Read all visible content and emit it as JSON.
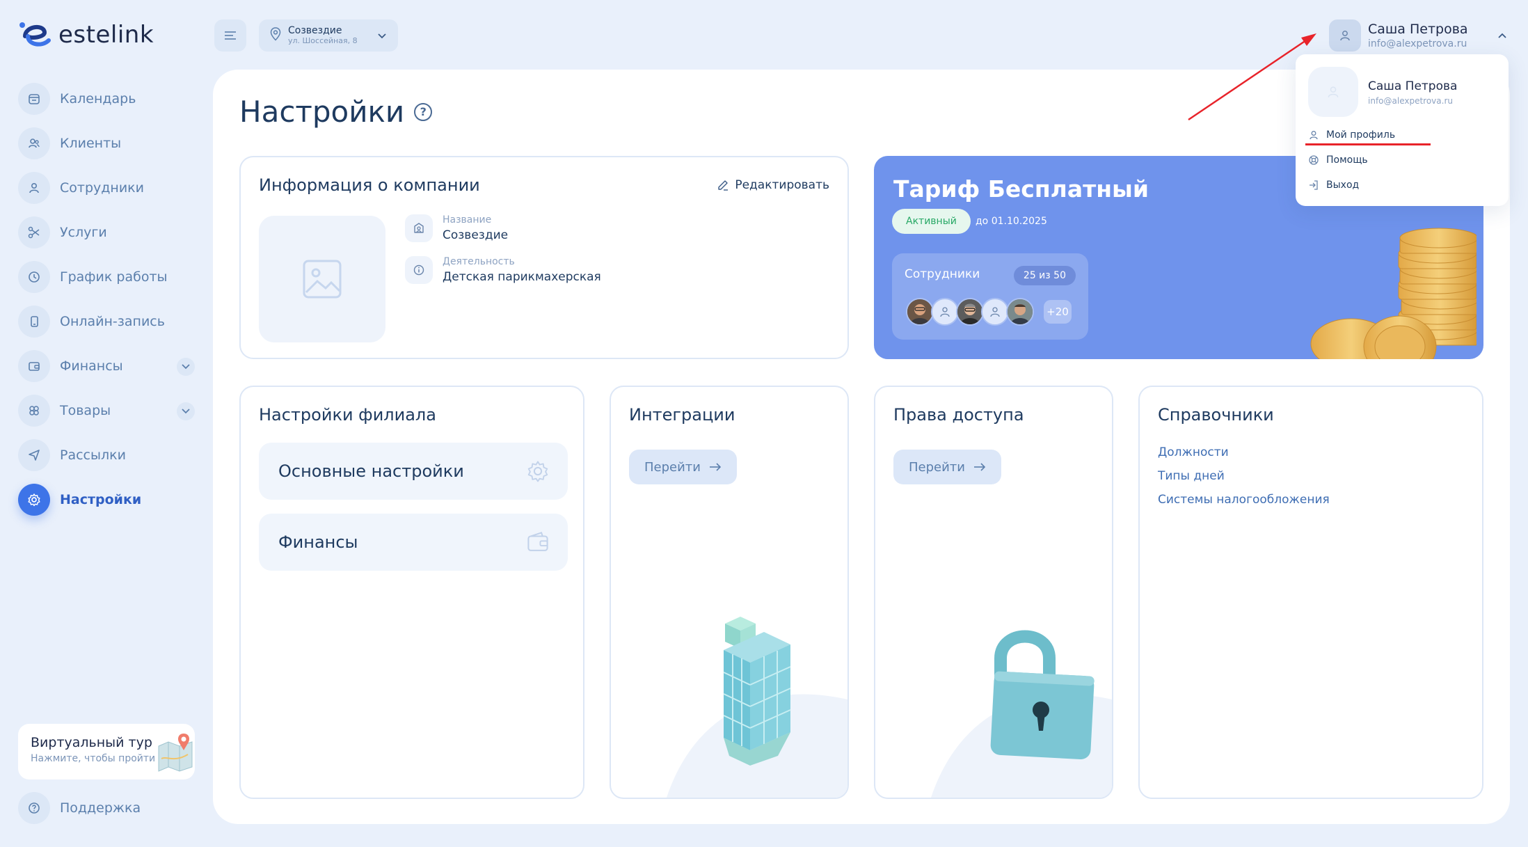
{
  "app": {
    "logo_text": "estelink"
  },
  "sidebar": {
    "items": [
      {
        "label": "Календарь",
        "icon": "calendar-icon"
      },
      {
        "label": "Клиенты",
        "icon": "clients-icon"
      },
      {
        "label": "Сотрудники",
        "icon": "employee-icon"
      },
      {
        "label": "Услуги",
        "icon": "scissors-icon"
      },
      {
        "label": "График работы",
        "icon": "clock-icon"
      },
      {
        "label": "Онлайн-запись",
        "icon": "phone-icon"
      },
      {
        "label": "Финансы",
        "icon": "wallet-icon"
      },
      {
        "label": "Товары",
        "icon": "products-icon"
      },
      {
        "label": "Рассылки",
        "icon": "send-icon"
      },
      {
        "label": "Настройки",
        "icon": "gear-icon",
        "active": true
      }
    ],
    "tour_title": "Виртуальный тур",
    "tour_sub": "Нажмите, чтобы пройти",
    "support_label": "Поддержка"
  },
  "topbar": {
    "branch_name": "Созвездие",
    "branch_address": "ул. Шоссейная, 8",
    "user_name": "Саша Петрова",
    "user_email": "info@alexpetrova.ru"
  },
  "page": {
    "title": "Настройки"
  },
  "company": {
    "title": "Информация о компании",
    "edit_label": "Редактировать",
    "name_label": "Название",
    "name_value": "Созвездие",
    "activity_label": "Деятельность",
    "activity_value": "Детская парикмахерская"
  },
  "tariff": {
    "title": "Тариф Бесплатный",
    "status": "Активный",
    "until": "до 01.10.2025",
    "employees_label": "Сотрудники",
    "employees_count": "25 из 50",
    "more_count": "+20"
  },
  "branch_settings": {
    "title": "Настройки филиала",
    "main_label": "Основные настройки",
    "finance_label": "Финансы"
  },
  "integrations": {
    "title": "Интеграции",
    "go_label": "Перейти"
  },
  "access": {
    "title": "Права доступа",
    "go_label": "Перейти"
  },
  "references": {
    "title": "Справочники",
    "links": [
      "Должности",
      "Типы дней",
      "Системы налогообложения"
    ]
  },
  "dropdown": {
    "name": "Саша Петрова",
    "email": "info@alexpetrova.ru",
    "profile_label": "Мой профиль",
    "help_label": "Помощь",
    "logout_label": "Выход"
  },
  "colors": {
    "accent": "#3d74e8",
    "tariff_bg": "#6f93ec",
    "annotation": "#e8232a"
  }
}
